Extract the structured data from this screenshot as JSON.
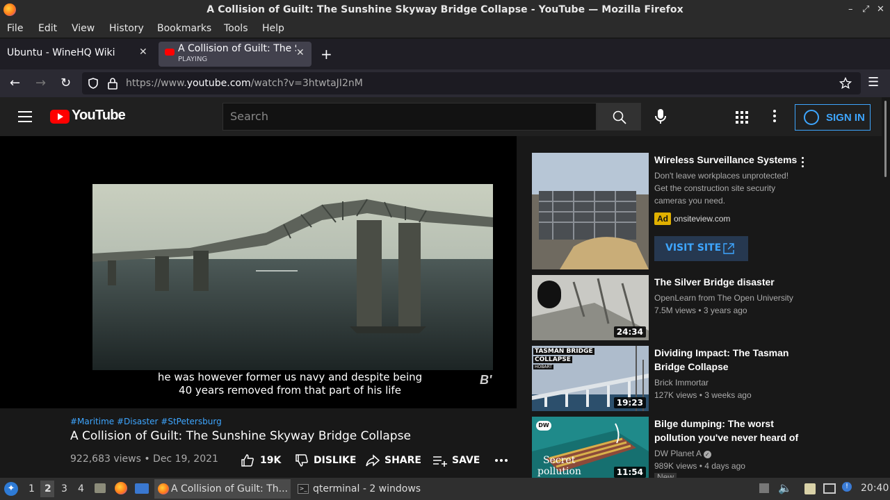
{
  "window": {
    "title": "A Collision of Guilt: The Sunshine Skyway Bridge Collapse - YouTube — Mozilla Firefox",
    "controls": [
      "–",
      "⤢",
      "✕"
    ]
  },
  "menu": [
    "File",
    "Edit",
    "View",
    "History",
    "Bookmarks",
    "Tools",
    "Help"
  ],
  "tabs": [
    {
      "label": "Ubuntu - WineHQ Wiki"
    },
    {
      "label": "A Collision of Guilt: The Sunshine Skyway",
      "status": "PLAYING"
    }
  ],
  "url": {
    "prefix": "https://www.",
    "domain": "youtube.com",
    "path": "/watch?v=3htwtaJI2nM"
  },
  "youtube": {
    "logo_text": "YouTube",
    "search_placeholder": "Search",
    "sign_in": "SIGN IN"
  },
  "video": {
    "caption_line1": "he was however former us navy and despite being",
    "caption_line2": "40 years removed from that part of his life",
    "channel_mark": "B'",
    "hashtags": "#Maritime #Disaster #StPetersburg",
    "title": "A Collision of Guilt: The Sunshine Skyway Bridge Collapse",
    "meta": "922,683 views • Dec 19, 2021",
    "likes": "19K",
    "dislike": "DISLIKE",
    "share": "SHARE",
    "save": "SAVE"
  },
  "ad": {
    "title": "Wireless Surveillance Systems",
    "description": "Don't leave workplaces unprotected! Get the construction site security cameras you need.",
    "badge": "Ad",
    "domain": "onsiteview.com",
    "cta": "VISIT SITE"
  },
  "recommendations": [
    {
      "title": "The Silver Bridge disaster",
      "channel": "OpenLearn from The Open University",
      "meta": "7.5M views • 3 years ago",
      "duration": "24:34"
    },
    {
      "title": "Dividing Impact: The Tasman Bridge Collapse",
      "channel": "Brick Immortar",
      "meta": "127K views • 3 weeks ago",
      "duration": "19:23",
      "thumb_text1": "TASMAN BRIDGE",
      "thumb_text2": "COLLAPSE",
      "thumb_text3": "HOBART"
    },
    {
      "title": "Bilge dumping: The worst pollution you've never heard of",
      "channel": "DW Planet A",
      "meta": "989K views • 4 days ago",
      "duration": "11:54",
      "thumb_text1": "Secret",
      "thumb_text2": "pollution",
      "thumb_logo": "DW",
      "badge": "New"
    }
  ],
  "taskbar": {
    "workspaces": [
      "1",
      "2",
      "3",
      "4"
    ],
    "tasks": [
      "A Collision of Guilt: Th...",
      "qterminal - 2 windows"
    ],
    "clock": "20:40"
  }
}
